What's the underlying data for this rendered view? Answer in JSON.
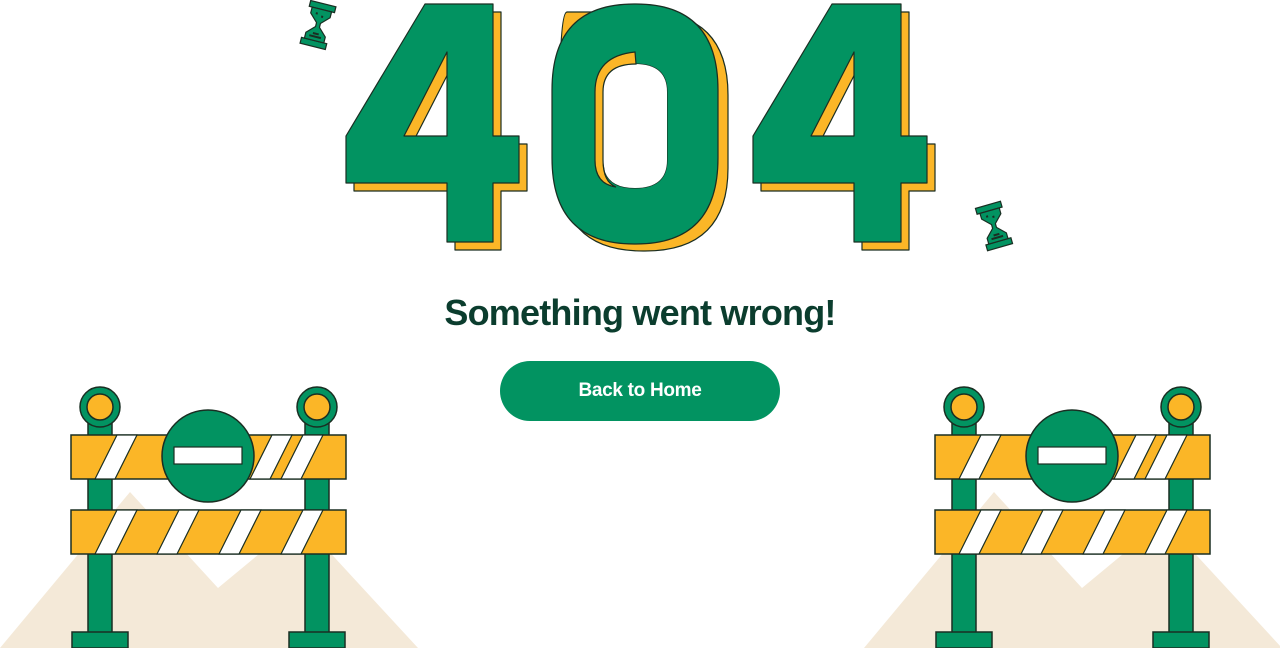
{
  "error": {
    "code_text": "404",
    "headline": "Something went wrong!"
  },
  "actions": {
    "home_label": "Back to Home"
  },
  "icons": {
    "hourglass_left": "hourglass-icon",
    "hourglass_right": "hourglass-icon",
    "no_entry_sign": "no-entry-icon"
  },
  "colors": {
    "primary_green": "#029361",
    "accent_yellow": "#FBB627",
    "headline_text": "#0b3d2e",
    "sand": "#F4E9D8",
    "outline": "#1a2e22"
  }
}
